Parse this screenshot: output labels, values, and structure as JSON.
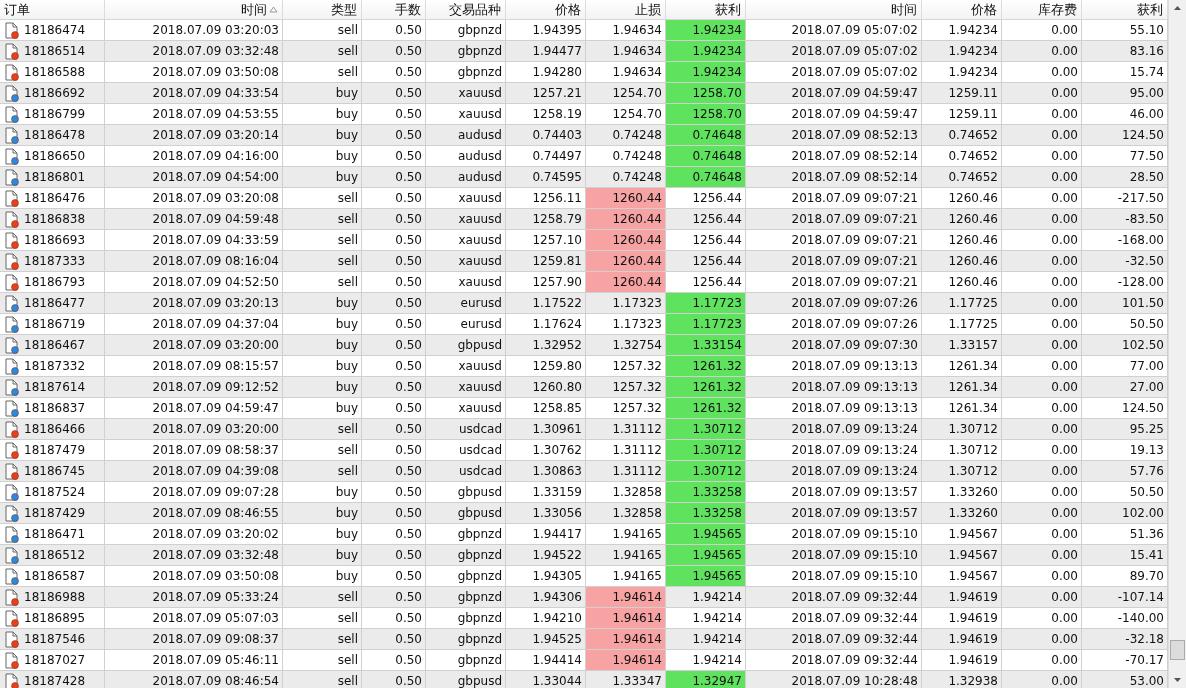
{
  "table": {
    "columns": [
      {
        "label": "订单",
        "sorted": false
      },
      {
        "label": "时间",
        "sorted": true
      },
      {
        "label": "类型",
        "sorted": false
      },
      {
        "label": "手数",
        "sorted": false
      },
      {
        "label": "交易品种",
        "sorted": false
      },
      {
        "label": "价格",
        "sorted": false
      },
      {
        "label": "止损",
        "sorted": false
      },
      {
        "label": "获利",
        "sorted": false
      },
      {
        "label": "时间",
        "sorted": false
      },
      {
        "label": "价格",
        "sorted": false
      },
      {
        "label": "库存费",
        "sorted": false
      },
      {
        "label": "获利",
        "sorted": false
      }
    ],
    "rows": [
      {
        "kind": "sell",
        "order": "18186474",
        "time": "2018.07.09 03:20:03",
        "type": "sell",
        "lots": "0.50",
        "symbol": "gbpnzd",
        "price": "1.94395",
        "sl": "1.94634",
        "sl_hit": false,
        "tp": "1.94234",
        "tp_hit": true,
        "close_time": "2018.07.09 05:07:02",
        "close_price": "1.94234",
        "swap": "0.00",
        "profit": "55.10"
      },
      {
        "kind": "sell",
        "order": "18186514",
        "time": "2018.07.09 03:32:48",
        "type": "sell",
        "lots": "0.50",
        "symbol": "gbpnzd",
        "price": "1.94477",
        "sl": "1.94634",
        "sl_hit": false,
        "tp": "1.94234",
        "tp_hit": true,
        "close_time": "2018.07.09 05:07:02",
        "close_price": "1.94234",
        "swap": "0.00",
        "profit": "83.16"
      },
      {
        "kind": "sell",
        "order": "18186588",
        "time": "2018.07.09 03:50:08",
        "type": "sell",
        "lots": "0.50",
        "symbol": "gbpnzd",
        "price": "1.94280",
        "sl": "1.94634",
        "sl_hit": false,
        "tp": "1.94234",
        "tp_hit": true,
        "close_time": "2018.07.09 05:07:02",
        "close_price": "1.94234",
        "swap": "0.00",
        "profit": "15.74"
      },
      {
        "kind": "buy",
        "order": "18186692",
        "time": "2018.07.09 04:33:54",
        "type": "buy",
        "lots": "0.50",
        "symbol": "xauusd",
        "price": "1257.21",
        "sl": "1254.70",
        "sl_hit": false,
        "tp": "1258.70",
        "tp_hit": true,
        "close_time": "2018.07.09 04:59:47",
        "close_price": "1259.11",
        "swap": "0.00",
        "profit": "95.00"
      },
      {
        "kind": "buy",
        "order": "18186799",
        "time": "2018.07.09 04:53:55",
        "type": "buy",
        "lots": "0.50",
        "symbol": "xauusd",
        "price": "1258.19",
        "sl": "1254.70",
        "sl_hit": false,
        "tp": "1258.70",
        "tp_hit": true,
        "close_time": "2018.07.09 04:59:47",
        "close_price": "1259.11",
        "swap": "0.00",
        "profit": "46.00"
      },
      {
        "kind": "buy",
        "order": "18186478",
        "time": "2018.07.09 03:20:14",
        "type": "buy",
        "lots": "0.50",
        "symbol": "audusd",
        "price": "0.74403",
        "sl": "0.74248",
        "sl_hit": false,
        "tp": "0.74648",
        "tp_hit": true,
        "close_time": "2018.07.09 08:52:13",
        "close_price": "0.74652",
        "swap": "0.00",
        "profit": "124.50"
      },
      {
        "kind": "buy",
        "order": "18186650",
        "time": "2018.07.09 04:16:00",
        "type": "buy",
        "lots": "0.50",
        "symbol": "audusd",
        "price": "0.74497",
        "sl": "0.74248",
        "sl_hit": false,
        "tp": "0.74648",
        "tp_hit": true,
        "close_time": "2018.07.09 08:52:14",
        "close_price": "0.74652",
        "swap": "0.00",
        "profit": "77.50"
      },
      {
        "kind": "buy",
        "order": "18186801",
        "time": "2018.07.09 04:54:00",
        "type": "buy",
        "lots": "0.50",
        "symbol": "audusd",
        "price": "0.74595",
        "sl": "0.74248",
        "sl_hit": false,
        "tp": "0.74648",
        "tp_hit": true,
        "close_time": "2018.07.09 08:52:14",
        "close_price": "0.74652",
        "swap": "0.00",
        "profit": "28.50"
      },
      {
        "kind": "sell",
        "order": "18186476",
        "time": "2018.07.09 03:20:08",
        "type": "sell",
        "lots": "0.50",
        "symbol": "xauusd",
        "price": "1256.11",
        "sl": "1260.44",
        "sl_hit": true,
        "tp": "1256.44",
        "tp_hit": false,
        "close_time": "2018.07.09 09:07:21",
        "close_price": "1260.46",
        "swap": "0.00",
        "profit": "-217.50"
      },
      {
        "kind": "sell",
        "order": "18186838",
        "time": "2018.07.09 04:59:48",
        "type": "sell",
        "lots": "0.50",
        "symbol": "xauusd",
        "price": "1258.79",
        "sl": "1260.44",
        "sl_hit": true,
        "tp": "1256.44",
        "tp_hit": false,
        "close_time": "2018.07.09 09:07:21",
        "close_price": "1260.46",
        "swap": "0.00",
        "profit": "-83.50"
      },
      {
        "kind": "sell",
        "order": "18186693",
        "time": "2018.07.09 04:33:59",
        "type": "sell",
        "lots": "0.50",
        "symbol": "xauusd",
        "price": "1257.10",
        "sl": "1260.44",
        "sl_hit": true,
        "tp": "1256.44",
        "tp_hit": false,
        "close_time": "2018.07.09 09:07:21",
        "close_price": "1260.46",
        "swap": "0.00",
        "profit": "-168.00"
      },
      {
        "kind": "sell",
        "order": "18187333",
        "time": "2018.07.09 08:16:04",
        "type": "sell",
        "lots": "0.50",
        "symbol": "xauusd",
        "price": "1259.81",
        "sl": "1260.44",
        "sl_hit": true,
        "tp": "1256.44",
        "tp_hit": false,
        "close_time": "2018.07.09 09:07:21",
        "close_price": "1260.46",
        "swap": "0.00",
        "profit": "-32.50"
      },
      {
        "kind": "sell",
        "order": "18186793",
        "time": "2018.07.09 04:52:50",
        "type": "sell",
        "lots": "0.50",
        "symbol": "xauusd",
        "price": "1257.90",
        "sl": "1260.44",
        "sl_hit": true,
        "tp": "1256.44",
        "tp_hit": false,
        "close_time": "2018.07.09 09:07:21",
        "close_price": "1260.46",
        "swap": "0.00",
        "profit": "-128.00"
      },
      {
        "kind": "buy",
        "order": "18186477",
        "time": "2018.07.09 03:20:13",
        "type": "buy",
        "lots": "0.50",
        "symbol": "eurusd",
        "price": "1.17522",
        "sl": "1.17323",
        "sl_hit": false,
        "tp": "1.17723",
        "tp_hit": true,
        "close_time": "2018.07.09 09:07:26",
        "close_price": "1.17725",
        "swap": "0.00",
        "profit": "101.50"
      },
      {
        "kind": "buy",
        "order": "18186719",
        "time": "2018.07.09 04:37:04",
        "type": "buy",
        "lots": "0.50",
        "symbol": "eurusd",
        "price": "1.17624",
        "sl": "1.17323",
        "sl_hit": false,
        "tp": "1.17723",
        "tp_hit": true,
        "close_time": "2018.07.09 09:07:26",
        "close_price": "1.17725",
        "swap": "0.00",
        "profit": "50.50"
      },
      {
        "kind": "buy",
        "order": "18186467",
        "time": "2018.07.09 03:20:00",
        "type": "buy",
        "lots": "0.50",
        "symbol": "gbpusd",
        "price": "1.32952",
        "sl": "1.32754",
        "sl_hit": false,
        "tp": "1.33154",
        "tp_hit": true,
        "close_time": "2018.07.09 09:07:30",
        "close_price": "1.33157",
        "swap": "0.00",
        "profit": "102.50"
      },
      {
        "kind": "buy",
        "order": "18187332",
        "time": "2018.07.09 08:15:57",
        "type": "buy",
        "lots": "0.50",
        "symbol": "xauusd",
        "price": "1259.80",
        "sl": "1257.32",
        "sl_hit": false,
        "tp": "1261.32",
        "tp_hit": true,
        "close_time": "2018.07.09 09:13:13",
        "close_price": "1261.34",
        "swap": "0.00",
        "profit": "77.00"
      },
      {
        "kind": "buy",
        "order": "18187614",
        "time": "2018.07.09 09:12:52",
        "type": "buy",
        "lots": "0.50",
        "symbol": "xauusd",
        "price": "1260.80",
        "sl": "1257.32",
        "sl_hit": false,
        "tp": "1261.32",
        "tp_hit": true,
        "close_time": "2018.07.09 09:13:13",
        "close_price": "1261.34",
        "swap": "0.00",
        "profit": "27.00"
      },
      {
        "kind": "buy",
        "order": "18186837",
        "time": "2018.07.09 04:59:47",
        "type": "buy",
        "lots": "0.50",
        "symbol": "xauusd",
        "price": "1258.85",
        "sl": "1257.32",
        "sl_hit": false,
        "tp": "1261.32",
        "tp_hit": true,
        "close_time": "2018.07.09 09:13:13",
        "close_price": "1261.34",
        "swap": "0.00",
        "profit": "124.50"
      },
      {
        "kind": "sell",
        "order": "18186466",
        "time": "2018.07.09 03:20:00",
        "type": "sell",
        "lots": "0.50",
        "symbol": "usdcad",
        "price": "1.30961",
        "sl": "1.31112",
        "sl_hit": false,
        "tp": "1.30712",
        "tp_hit": true,
        "close_time": "2018.07.09 09:13:24",
        "close_price": "1.30712",
        "swap": "0.00",
        "profit": "95.25"
      },
      {
        "kind": "sell",
        "order": "18187479",
        "time": "2018.07.09 08:58:37",
        "type": "sell",
        "lots": "0.50",
        "symbol": "usdcad",
        "price": "1.30762",
        "sl": "1.31112",
        "sl_hit": false,
        "tp": "1.30712",
        "tp_hit": true,
        "close_time": "2018.07.09 09:13:24",
        "close_price": "1.30712",
        "swap": "0.00",
        "profit": "19.13"
      },
      {
        "kind": "sell",
        "order": "18186745",
        "time": "2018.07.09 04:39:08",
        "type": "sell",
        "lots": "0.50",
        "symbol": "usdcad",
        "price": "1.30863",
        "sl": "1.31112",
        "sl_hit": false,
        "tp": "1.30712",
        "tp_hit": true,
        "close_time": "2018.07.09 09:13:24",
        "close_price": "1.30712",
        "swap": "0.00",
        "profit": "57.76"
      },
      {
        "kind": "buy",
        "order": "18187524",
        "time": "2018.07.09 09:07:28",
        "type": "buy",
        "lots": "0.50",
        "symbol": "gbpusd",
        "price": "1.33159",
        "sl": "1.32858",
        "sl_hit": false,
        "tp": "1.33258",
        "tp_hit": true,
        "close_time": "2018.07.09 09:13:57",
        "close_price": "1.33260",
        "swap": "0.00",
        "profit": "50.50"
      },
      {
        "kind": "buy",
        "order": "18187429",
        "time": "2018.07.09 08:46:55",
        "type": "buy",
        "lots": "0.50",
        "symbol": "gbpusd",
        "price": "1.33056",
        "sl": "1.32858",
        "sl_hit": false,
        "tp": "1.33258",
        "tp_hit": true,
        "close_time": "2018.07.09 09:13:57",
        "close_price": "1.33260",
        "swap": "0.00",
        "profit": "102.00"
      },
      {
        "kind": "buy",
        "order": "18186471",
        "time": "2018.07.09 03:20:02",
        "type": "buy",
        "lots": "0.50",
        "symbol": "gbpnzd",
        "price": "1.94417",
        "sl": "1.94165",
        "sl_hit": false,
        "tp": "1.94565",
        "tp_hit": true,
        "close_time": "2018.07.09 09:15:10",
        "close_price": "1.94567",
        "swap": "0.00",
        "profit": "51.36"
      },
      {
        "kind": "buy",
        "order": "18186512",
        "time": "2018.07.09 03:32:48",
        "type": "buy",
        "lots": "0.50",
        "symbol": "gbpnzd",
        "price": "1.94522",
        "sl": "1.94165",
        "sl_hit": false,
        "tp": "1.94565",
        "tp_hit": true,
        "close_time": "2018.07.09 09:15:10",
        "close_price": "1.94567",
        "swap": "0.00",
        "profit": "15.41"
      },
      {
        "kind": "buy",
        "order": "18186587",
        "time": "2018.07.09 03:50:08",
        "type": "buy",
        "lots": "0.50",
        "symbol": "gbpnzd",
        "price": "1.94305",
        "sl": "1.94165",
        "sl_hit": false,
        "tp": "1.94565",
        "tp_hit": true,
        "close_time": "2018.07.09 09:15:10",
        "close_price": "1.94567",
        "swap": "0.00",
        "profit": "89.70"
      },
      {
        "kind": "sell",
        "order": "18186988",
        "time": "2018.07.09 05:33:24",
        "type": "sell",
        "lots": "0.50",
        "symbol": "gbpnzd",
        "price": "1.94306",
        "sl": "1.94614",
        "sl_hit": true,
        "tp": "1.94214",
        "tp_hit": false,
        "close_time": "2018.07.09 09:32:44",
        "close_price": "1.94619",
        "swap": "0.00",
        "profit": "-107.14"
      },
      {
        "kind": "sell",
        "order": "18186895",
        "time": "2018.07.09 05:07:03",
        "type": "sell",
        "lots": "0.50",
        "symbol": "gbpnzd",
        "price": "1.94210",
        "sl": "1.94614",
        "sl_hit": true,
        "tp": "1.94214",
        "tp_hit": false,
        "close_time": "2018.07.09 09:32:44",
        "close_price": "1.94619",
        "swap": "0.00",
        "profit": "-140.00"
      },
      {
        "kind": "sell",
        "order": "18187546",
        "time": "2018.07.09 09:08:37",
        "type": "sell",
        "lots": "0.50",
        "symbol": "gbpnzd",
        "price": "1.94525",
        "sl": "1.94614",
        "sl_hit": true,
        "tp": "1.94214",
        "tp_hit": false,
        "close_time": "2018.07.09 09:32:44",
        "close_price": "1.94619",
        "swap": "0.00",
        "profit": "-32.18"
      },
      {
        "kind": "sell",
        "order": "18187027",
        "time": "2018.07.09 05:46:11",
        "type": "sell",
        "lots": "0.50",
        "symbol": "gbpnzd",
        "price": "1.94414",
        "sl": "1.94614",
        "sl_hit": true,
        "tp": "1.94214",
        "tp_hit": false,
        "close_time": "2018.07.09 09:32:44",
        "close_price": "1.94619",
        "swap": "0.00",
        "profit": "-70.17"
      },
      {
        "kind": "sell",
        "order": "18187428",
        "time": "2018.07.09 08:46:54",
        "type": "sell",
        "lots": "0.50",
        "symbol": "gbpusd",
        "price": "1.33044",
        "sl": "1.33347",
        "sl_hit": false,
        "tp": "1.32947",
        "tp_hit": true,
        "close_time": "2018.07.09 10:28:48",
        "close_price": "1.32938",
        "swap": "0.00",
        "profit": "53.00"
      }
    ]
  }
}
